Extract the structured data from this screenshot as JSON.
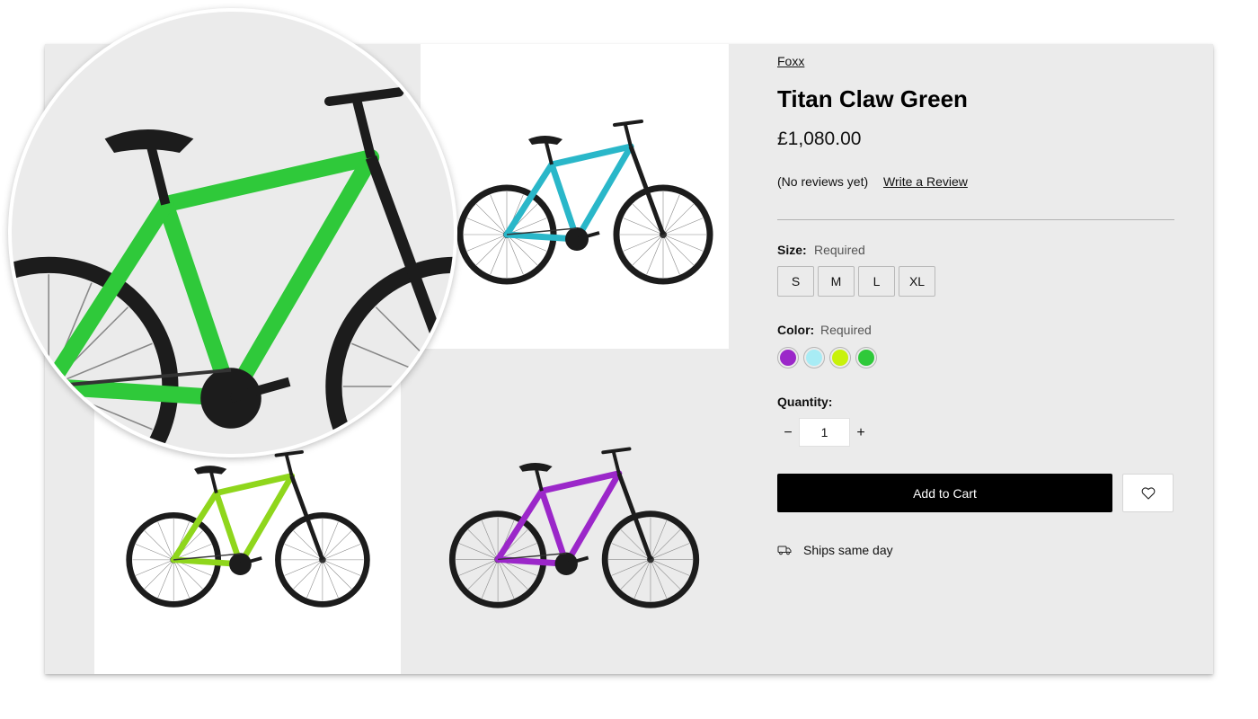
{
  "product": {
    "brand": "Foxx",
    "title": "Titan Claw Green",
    "price": "£1,080.00",
    "reviews_text": "(No reviews yet)",
    "write_review_label": "Write a Review"
  },
  "options": {
    "size": {
      "label": "Size:",
      "required_text": "Required",
      "values": [
        "S",
        "M",
        "L",
        "XL"
      ]
    },
    "color": {
      "label": "Color:",
      "required_text": "Required",
      "swatches": [
        {
          "name": "purple",
          "hex": "#9b27c9"
        },
        {
          "name": "light-cyan",
          "hex": "#a8ecf5"
        },
        {
          "name": "lime",
          "hex": "#c8f20a"
        },
        {
          "name": "green",
          "hex": "#2fc93a"
        }
      ]
    }
  },
  "quantity": {
    "label": "Quantity:",
    "value": "1",
    "decrement_label": "−",
    "increment_label": "+"
  },
  "actions": {
    "add_to_cart_label": "Add to Cart",
    "wishlist_icon": "heart-icon"
  },
  "shipping": {
    "icon": "truck-icon",
    "text": "Ships same day"
  },
  "gallery": {
    "images": [
      {
        "position": "top-left",
        "frame_color": "#2fc93a",
        "bg": "#ebebeb"
      },
      {
        "position": "top-right",
        "frame_color": "#2ab7c9",
        "bg": "#ffffff"
      },
      {
        "position": "bottom-left",
        "frame_color": "#8fd61c",
        "bg": "#ffffff"
      },
      {
        "position": "bottom-right",
        "frame_color": "#9b27c9",
        "bg": "#ebebeb"
      }
    ],
    "zoom_frame_color": "#2fc93a"
  }
}
